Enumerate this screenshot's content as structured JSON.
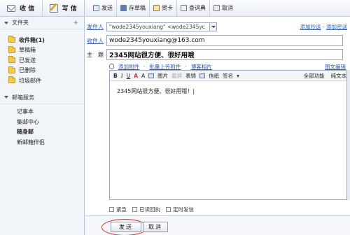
{
  "sidebar": {
    "compose_buttons": [
      {
        "label": "收 信",
        "icon": "envelope-icon"
      },
      {
        "label": "写 信",
        "icon": "pencil-icon"
      }
    ],
    "folders_title": "文件夹",
    "folders_add": "+",
    "folders": [
      {
        "label": "收件箱(1)",
        "active": true
      },
      {
        "label": "草稿箱",
        "active": false
      },
      {
        "label": "已发送",
        "active": false
      },
      {
        "label": "已删除",
        "active": false
      },
      {
        "label": "垃圾邮件",
        "active": false
      }
    ],
    "services_title": "邮箱服务",
    "services": [
      {
        "label": "记事本",
        "active": false
      },
      {
        "label": "集邮中心",
        "active": false
      },
      {
        "label": "随身邮",
        "active": true
      },
      {
        "label": "新邮箱伴侣",
        "active": false
      }
    ]
  },
  "toolbar": {
    "items": [
      {
        "label": "发送",
        "icon": "send-icon"
      },
      {
        "label": "存草稿",
        "icon": "save-draft-icon"
      },
      {
        "label": "贺卡",
        "icon": "greeting-card-icon"
      },
      {
        "label": "查词典",
        "icon": "dictionary-icon"
      },
      {
        "label": "取消",
        "icon": "cancel-icon"
      }
    ]
  },
  "form": {
    "sender_label": "发件人",
    "sender_value": "\"wode2345youxiang\" <wode2345yc",
    "cc_links": [
      "添加抄送",
      "添加密送"
    ],
    "cc_separator": " - ",
    "recipient_label": "收件人",
    "recipient_value": "wode2345youxiang@163.com",
    "subject_label": "主　题",
    "subject_value": "2345网站很方便、很好用哦",
    "attach_links": [
      "添加附件",
      "批量上传附件",
      "博客相片"
    ],
    "attach_sep": "·",
    "right_link": "图文编辑"
  },
  "editor": {
    "tools": {
      "bold": "B",
      "italic": "I",
      "underline": "U",
      "font_color": "A",
      "font_size": "A",
      "image": "图片",
      "screenshot": "截屏",
      "emoji": "表情",
      "stationery": "信纸",
      "signature": "签名",
      "signature_caret": "▾",
      "all_functions": "全部功能",
      "plain_text": "纯文本"
    },
    "body": "2345网站很方便、很好用哦！|"
  },
  "options": [
    "紧急",
    "已读回执",
    "定时发信"
  ],
  "buttons": {
    "send": "发送",
    "cancel": "取消"
  }
}
